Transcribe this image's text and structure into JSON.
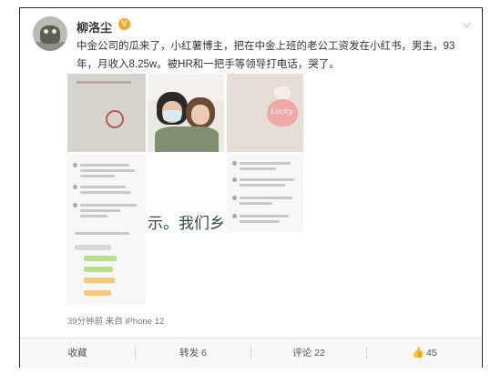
{
  "post": {
    "username": "柳洛尘",
    "verified_badge": "V",
    "dropdown_icon": "chevron-down-icon",
    "content": "中金公司的瓜来了，小红薯博主，把在中金上班的老公工资发在小红书，男主，93年，月收入8.25w。被HR和一把手等领导打电话，哭了。",
    "image5_text": "示。我们乡",
    "image3_text": "Lucky",
    "meta": "39分钟前  来自 iPhone 12"
  },
  "actions": {
    "favorite": "收藏",
    "repost": "转发 6",
    "comment": "评论 22",
    "like": "45"
  },
  "colors": {
    "verified": "#f5a623",
    "border": "#2b2b2b",
    "toolbar_bg": "#f7f7f7"
  }
}
